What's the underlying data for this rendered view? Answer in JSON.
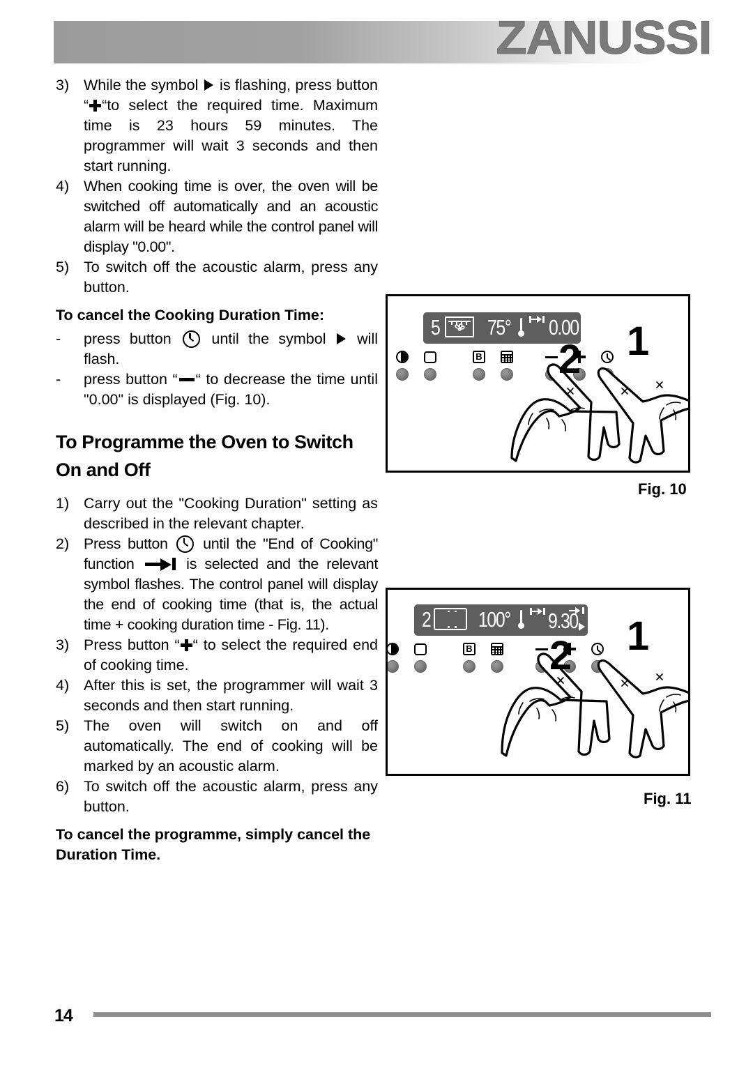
{
  "header": {
    "brand": "ZANUSSI"
  },
  "body": {
    "items": [
      {
        "type": "numbered",
        "marker": "3)",
        "segments": [
          {
            "text": "While the symbol "
          },
          {
            "icon": "play-triangle-icon"
          },
          {
            "text": " is flashing, press button “"
          },
          {
            "icon": "plus-icon"
          },
          {
            "text": "“to select the required time. Maximum time is 23 hours 59 minutes. The programmer will wait 3 seconds and then start running."
          }
        ]
      },
      {
        "type": "numbered",
        "marker": "4)",
        "segments": [
          {
            "text": "When cooking time is over, the oven will be switched off automatically and an acoustic alarm will be heard while the control panel will display \"0.00\"."
          }
        ]
      },
      {
        "type": "numbered",
        "marker": "5)",
        "segments": [
          {
            "text": "To switch off the acoustic alarm, press any button."
          }
        ]
      },
      {
        "type": "subheading",
        "text": "To cancel the Cooking Duration Time:"
      },
      {
        "type": "dash",
        "marker": "-",
        "segments": [
          {
            "text": "press button "
          },
          {
            "icon": "clock-icon"
          },
          {
            "text": " until the symbol "
          },
          {
            "icon": "play-triangle-icon"
          },
          {
            "text": " will flash."
          }
        ]
      },
      {
        "type": "dash",
        "marker": "-",
        "segments": [
          {
            "text": " press button “"
          },
          {
            "icon": "minus-icon"
          },
          {
            "text": "“ to decrease the time until \"0.00\" is displayed (Fig. 10)."
          }
        ]
      },
      {
        "type": "title",
        "text": "To Programme the Oven to Switch On and Off"
      },
      {
        "type": "numbered",
        "marker": "1)",
        "segments": [
          {
            "text": "Carry out the \"Cooking Duration\" setting as described in the relevant chapter."
          }
        ]
      },
      {
        "type": "numbered",
        "marker": "2)",
        "segments": [
          {
            "text": "Press button "
          },
          {
            "icon": "clock-icon"
          },
          {
            "text": " until the \"End of Cooking\" function "
          },
          {
            "icon": "end-of-cooking-icon"
          },
          {
            "text": " is selected and the relevant symbol flashes. The control panel will display the end of cooking time (that is, the actual time + cooking duration time - Fig. 11)."
          }
        ]
      },
      {
        "type": "numbered",
        "marker": "3)",
        "segments": [
          {
            "text": "Press button “"
          },
          {
            "icon": "plus-icon"
          },
          {
            "text": "“ to select the required end of cooking time."
          }
        ]
      },
      {
        "type": "numbered",
        "marker": "4)",
        "segments": [
          {
            "text": "After this is set, the programmer will wait 3 seconds and then start running."
          }
        ]
      },
      {
        "type": "numbered",
        "marker": "5)",
        "segments": [
          {
            "text": "The oven will switch on and off automatically. The end of cooking will be marked by an acoustic alarm."
          }
        ]
      },
      {
        "type": "numbered",
        "marker": "6)",
        "segments": [
          {
            "text": "To switch off the acoustic alarm, press any button."
          }
        ]
      },
      {
        "type": "subheading",
        "text": "To cancel the programme, simply cancel the Duration Time."
      }
    ]
  },
  "figures": [
    {
      "id": "fig10",
      "caption": "Fig. 10",
      "display": {
        "function_number": "5",
        "oven_icon": "fan-oven-icon",
        "temperature": "75°",
        "thermometer_icon": "thermometer-icon",
        "mode_symbol": "duration-time-icon",
        "time": "0.00"
      },
      "buttons": [
        {
          "name": "oven-light-button",
          "icon": "half-circle-light-icon",
          "label": ""
        },
        {
          "name": "function-button",
          "icon": "rounded-square-icon",
          "label": ""
        },
        {
          "name": "b-button",
          "icon": "b-box-icon",
          "label": "B"
        },
        {
          "name": "timer-grid-button",
          "icon": "grid-icon",
          "label": ""
        },
        {
          "name": "minus-button",
          "icon": "minus-icon",
          "label": ""
        },
        {
          "name": "plus-button",
          "icon": "plus-icon",
          "label": ""
        },
        {
          "name": "clock-button",
          "icon": "clock-icon",
          "label": ""
        }
      ],
      "hand_steps": [
        {
          "number": "2",
          "points_to": "minus-button"
        },
        {
          "number": "1",
          "points_to": "clock-button"
        }
      ]
    },
    {
      "id": "fig11",
      "caption": "Fig. 11",
      "display": {
        "function_number": "2",
        "oven_icon": "conventional-oven-icon",
        "temperature": "100°",
        "thermometer_icon": "thermometer-icon",
        "mode_symbol": "duration-time-icon",
        "end_symbol": "end-of-cooking-icon",
        "time": "9.30",
        "running_indicator": "play-triangle-icon"
      },
      "buttons": [
        {
          "name": "oven-light-button",
          "icon": "half-circle-light-icon",
          "label": ""
        },
        {
          "name": "function-button",
          "icon": "rounded-square-icon",
          "label": ""
        },
        {
          "name": "b-button",
          "icon": "b-box-icon",
          "label": "B"
        },
        {
          "name": "timer-grid-button",
          "icon": "grid-icon",
          "label": ""
        },
        {
          "name": "minus-button",
          "icon": "minus-icon",
          "label": ""
        },
        {
          "name": "plus-button",
          "icon": "plus-icon",
          "label": ""
        },
        {
          "name": "clock-button",
          "icon": "clock-icon",
          "label": ""
        }
      ],
      "hand_steps": [
        {
          "number": "2",
          "points_to": "plus-button"
        },
        {
          "number": "1",
          "points_to": "clock-button"
        }
      ]
    }
  ],
  "footer": {
    "page_number": "14"
  },
  "colors": {
    "lcd_background": "#5e5e5e",
    "lcd_text": "#ffffff",
    "brand_gray": "#7b7b7b",
    "rule_gray": "#8f8f8f"
  }
}
